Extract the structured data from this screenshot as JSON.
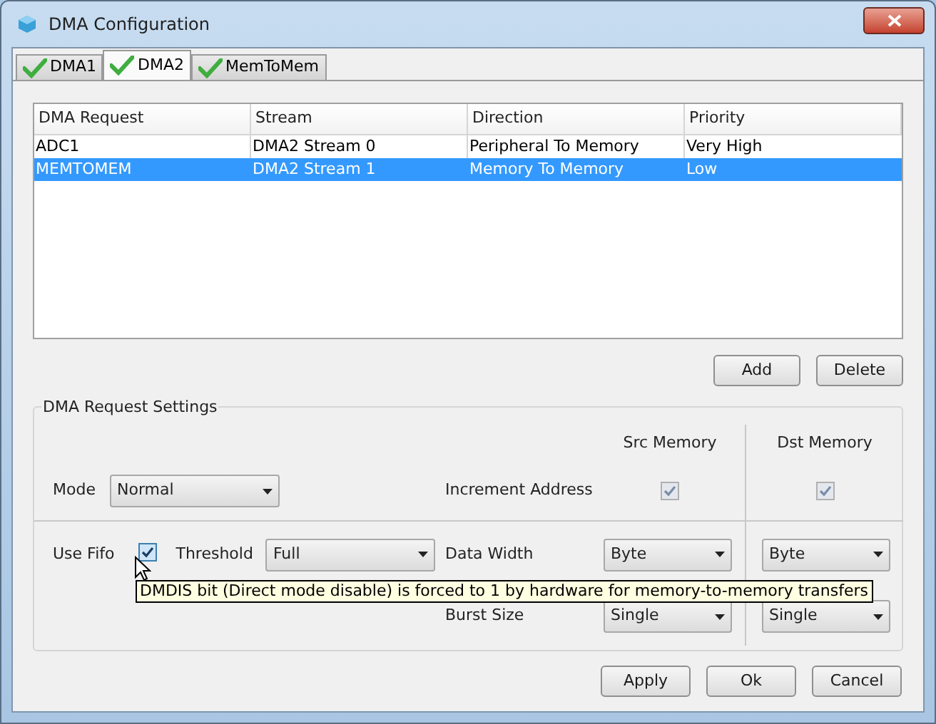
{
  "window": {
    "title": "DMA Configuration"
  },
  "tabs": [
    {
      "label": "DMA1",
      "selected": false
    },
    {
      "label": "DMA2",
      "selected": true
    },
    {
      "label": "MemToMem",
      "selected": false
    }
  ],
  "table": {
    "columns": [
      "DMA Request",
      "Stream",
      "Direction",
      "Priority"
    ],
    "rows": [
      {
        "cells": [
          "ADC1",
          "DMA2 Stream 0",
          "Peripheral To Memory",
          "Very High"
        ],
        "selected": false
      },
      {
        "cells": [
          "MEMTOMEM",
          "DMA2 Stream 1",
          "Memory To Memory",
          "Low"
        ],
        "selected": true
      }
    ]
  },
  "table_buttons": [
    "Add",
    "Delete"
  ],
  "settings": {
    "title": "DMA Request Settings",
    "column_headers": [
      "Src Memory",
      "Dst Memory"
    ],
    "mode": {
      "label": "Mode",
      "value": "Normal"
    },
    "increment_address": {
      "label": "Increment Address",
      "src": {
        "checked": true,
        "disabled": true
      },
      "dst": {
        "checked": true,
        "disabled": true
      }
    },
    "use_fifo": {
      "label": "Use Fifo",
      "checked": true
    },
    "threshold": {
      "label": "Threshold",
      "value": "Full"
    },
    "data_width": {
      "label": "Data Width",
      "src": "Byte",
      "dst": "Byte"
    },
    "burst_size": {
      "label": "Burst Size",
      "src": "Single",
      "dst": "Single"
    }
  },
  "tooltip": "DMDIS bit (Direct mode disable) is forced to 1 by hardware for memory-to-memory transfers",
  "dialog_buttons": [
    "Apply",
    "Ok",
    "Cancel"
  ]
}
